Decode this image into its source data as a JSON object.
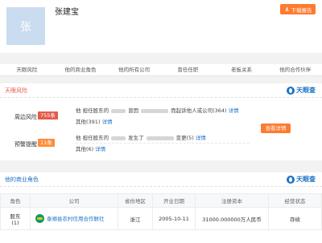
{
  "header": {
    "avatar_char": "张",
    "person_name": "张建宝",
    "report_button": "下载报告"
  },
  "tabs": [
    "天眼风险",
    "他的商业角色",
    "他的所有公司",
    "曾任任职",
    "老板关系",
    "他的合作伙伴"
  ],
  "risk": {
    "title": "天眼风险",
    "brand": "天眼查",
    "surrounding": {
      "label": "周边风险",
      "badge": "755条",
      "line1_prefix": "他 担任股东的",
      "line1_mid": "曾因",
      "line1_suffix": "而起诉他人或公司(364)",
      "line1_link": "详情",
      "line2_text": "其他(391)",
      "line2_link": "详情"
    },
    "warning": {
      "label": "预警提醒",
      "badge": "11条",
      "line1_prefix": "他 担任股东的",
      "line1_mid": "发生了",
      "line1_suffix": "变更(5)",
      "line1_link": "详情",
      "line2_text": "其他(6)",
      "line2_link": "详情"
    },
    "detail_button": "查看详情"
  },
  "business": {
    "title": "他的商业角色",
    "brand": "天眼查",
    "columns": [
      "角色",
      "公司",
      "省份地区",
      "开业日期",
      "注册资本",
      "经营状态"
    ],
    "rows": [
      {
        "role": "股东",
        "role_count": "(1)",
        "company": "泰顺县农村信用合作联社",
        "region": "浙江",
        "open_date": "2005-10-11",
        "capital": "31000.000000万人民币",
        "status": "存续"
      }
    ]
  },
  "colors": {
    "accent_orange": "#ff7a2e",
    "risk_red": "#e25b4a",
    "brand_blue": "#1a73c6",
    "status_green": "#1faa5a"
  }
}
